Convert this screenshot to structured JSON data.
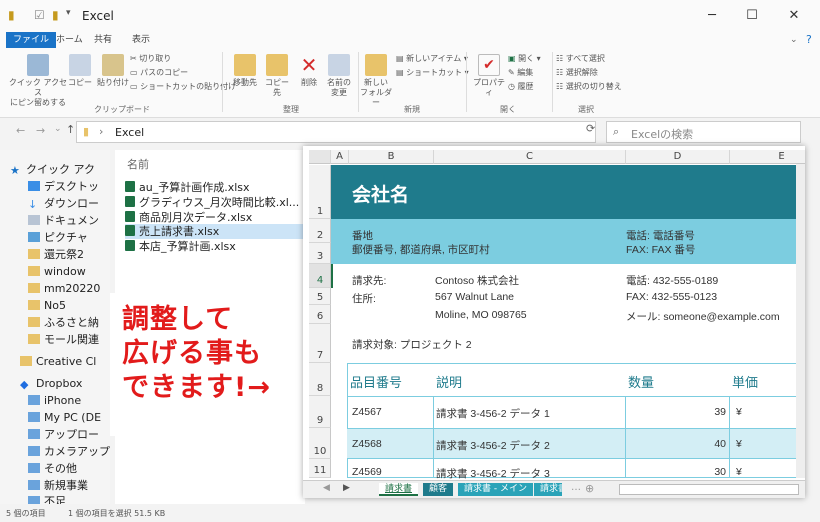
{
  "window": {
    "title": "Excel"
  },
  "ribbon": {
    "tabs": [
      "ファイル",
      "ホーム",
      "共有",
      "表示"
    ],
    "buttons": {
      "pin": "クイック アクセス\nにピン留めする",
      "copy": "コピー",
      "paste": "貼り付け",
      "cut": "切り取り",
      "copy_path": "パスのコピー",
      "paste_shortcut": "ショートカットの貼り付け",
      "move_to": "移動先",
      "copy_to": "コピー先",
      "delete": "削除",
      "rename": "名前の\n変更",
      "new_folder": "新しい\nフォルダー",
      "new_item": "新しいアイテム",
      "shortcut": "ショートカット",
      "properties": "プロパティ",
      "open": "開く",
      "edit": "編集",
      "history": "履歴",
      "select_all": "すべて選択",
      "select_none": "選択解除",
      "invert": "選択の切り替え"
    },
    "groups": [
      "クリップボード",
      "整理",
      "新規",
      "開く",
      "選択"
    ]
  },
  "address": {
    "path": "Excel",
    "search_placeholder": "Excelの検索"
  },
  "nav": {
    "items": [
      "クイック アク",
      "デスクトッ",
      "ダウンロー",
      "ドキュメン",
      "ピクチャ",
      "還元祭2",
      "window",
      "mm20220",
      "No5",
      "ふるさと納",
      "モール関連",
      "Creative Cl",
      "Dropbox",
      "iPhone",
      "My PC (DE",
      "アップロー",
      "カメラアップ",
      "その他",
      "新規事業",
      "不足"
    ]
  },
  "files": {
    "header": "名前",
    "items": [
      "au_予算計画作成.xlsx",
      "グラディウス_月次時間比較.xl...",
      "商品別月次データ.xlsx",
      "売上請求書.xlsx",
      "本店_予算計画.xlsx"
    ]
  },
  "status": {
    "count": "5 個の項目",
    "selected": "1 個の項目を選択  51.5 KB"
  },
  "note": {
    "line1": "調整して",
    "line2": "広げる事も",
    "line3": "できます!→"
  },
  "sheet": {
    "columns": [
      "A",
      "B",
      "C",
      "D",
      "E"
    ],
    "rows": [
      "1",
      "2",
      "3",
      "4",
      "5",
      "6",
      "7",
      "8",
      "9",
      "10",
      "11"
    ],
    "company": "会社名",
    "address_line": "番地",
    "address_line2": "郵便番号, 都道府県, 市区町村",
    "phone": "電話: 電話番号",
    "fax": "FAX: FAX 番号",
    "bill_to_label": "請求先:",
    "address_label": "住所:",
    "bill_to": "Contoso 株式会社",
    "street": "567 Walnut Lane",
    "city": "Moline, MO 098765",
    "phone2": "電話: 432-555-0189",
    "fax2": "FAX: 432-555-0123",
    "email": "メール: someone@example.com",
    "subject": "請求対象: プロジェクト 2",
    "table_headers": [
      "品目番号",
      "説明",
      "数量",
      "単価"
    ],
    "table_rows": [
      [
        "Z4567",
        "請求書 3-456-2 データ 1",
        "39",
        "¥"
      ],
      [
        "Z4568",
        "請求書 3-456-2 データ 2",
        "40",
        "¥"
      ],
      [
        "Z4569",
        "請求書 3-456-2 データ 3",
        "30",
        "¥"
      ]
    ],
    "tabs": [
      "請求書",
      "顧客",
      "請求書 - メイン",
      "請求書"
    ],
    "colors": {
      "teal": "#1f7b8c",
      "light": "#7ccde0",
      "band": "#d3eef5"
    }
  }
}
